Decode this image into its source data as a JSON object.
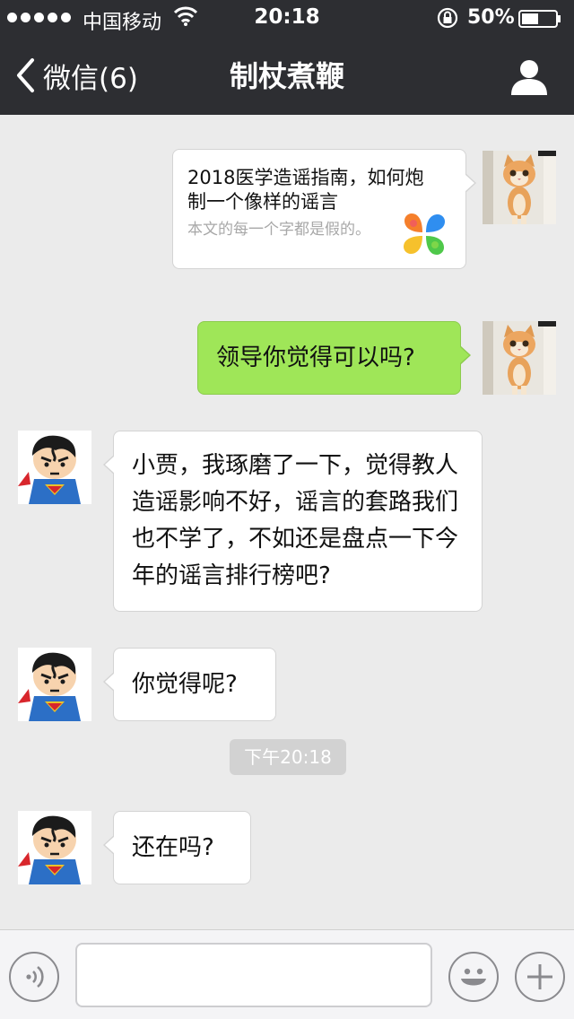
{
  "status_bar": {
    "carrier": "中国移动",
    "time": "20:18",
    "battery_percent": "50%",
    "battery_level": 0.5
  },
  "nav": {
    "back_label": "微信(6)",
    "title": "制杖煮鞭"
  },
  "messages": [
    {
      "side": "right",
      "type": "link",
      "title": "2018医学造谣指南，如何炮制一个像样的谣言",
      "desc": "本文的每一个字都是假的。",
      "icon": "colorful-flower-app-icon",
      "avatar": "kitten-avatar"
    },
    {
      "side": "right",
      "type": "text",
      "text": "领导你觉得可以吗?",
      "bubble_color": "#9fe658",
      "avatar": "kitten-avatar"
    },
    {
      "side": "left",
      "type": "text",
      "text": "小贾，我琢磨了一下，觉得教人造谣影响不好，谣言的套路我们也不学了，不如还是盘点一下今年的谣言排行榜吧?",
      "avatar": "superman-avatar"
    },
    {
      "side": "left",
      "type": "text",
      "text": "你觉得呢?",
      "avatar": "superman-avatar"
    },
    {
      "side": "left",
      "type": "text",
      "text": "还在吗?",
      "avatar": "superman-avatar"
    }
  ],
  "timestamp": "下午20:18",
  "input": {
    "value": "",
    "placeholder": ""
  },
  "colors": {
    "bar": "#2d2e32",
    "chat_bg": "#ebebeb",
    "green_bubble": "#9fe658"
  }
}
